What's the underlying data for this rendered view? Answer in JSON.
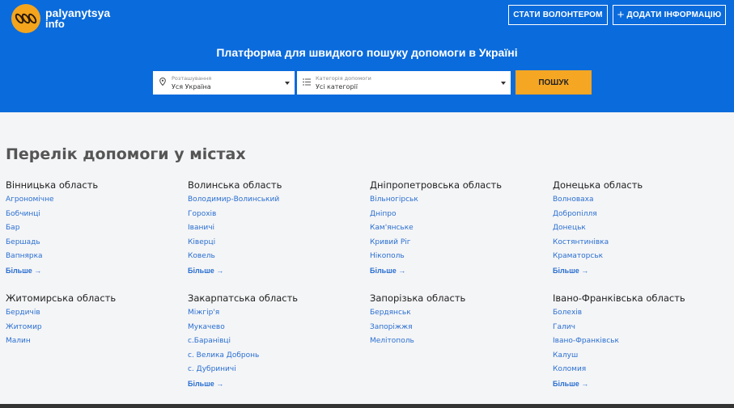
{
  "header": {
    "logo_line1": "palyanytsya",
    "logo_line2": "info",
    "volunteer_button": "СТАТИ ВОЛОНТЕРОМ",
    "add_button_plus": "+",
    "add_button": "ДОДАТИ ІНФОРМАЦІЮ",
    "hero_title": "Платформа для швидкого пошуку допомоги в Україні"
  },
  "search": {
    "region_label": "Розташування",
    "region_value": "Уся Україна",
    "category_label": "Категорія допомоги",
    "category_value": "Усі категорії",
    "search_button": "ПОШУК"
  },
  "main": {
    "section_title": "Перелік допомоги у містах",
    "more_label": "Більше →",
    "regions": [
      {
        "name": "Вінницька область",
        "cities": [
          "Агрономічне",
          "Бобчинці",
          "Бар",
          "Бершадь",
          "Вапнярка"
        ],
        "more": true
      },
      {
        "name": "Волинська область",
        "cities": [
          "Володимир-Волинський",
          "Горохів",
          "Іваничі",
          "Ківерці",
          "Ковель"
        ],
        "more": true
      },
      {
        "name": "Дніпропетровська область",
        "cities": [
          "Вільногірськ",
          "Дніпро",
          "Кам'янське",
          "Кривий Ріг",
          "Нікополь"
        ],
        "more": true
      },
      {
        "name": "Донецька область",
        "cities": [
          "Волноваха",
          "Добропілля",
          "Донецьк",
          "Костянтинівка",
          "Краматорськ"
        ],
        "more": true
      },
      {
        "name": "Житомирська область",
        "cities": [
          "Бердичів",
          "Житомир",
          "Малин"
        ],
        "more": false
      },
      {
        "name": "Закарпатська область",
        "cities": [
          "Міжгір'я",
          "Мукачево",
          "с.Баранівці",
          "с. Велика Добронь",
          "с. Дубриничі"
        ],
        "more": true
      },
      {
        "name": "Запорізька область",
        "cities": [
          "Бердянськ",
          "Запоріжжя",
          "Мелітополь"
        ],
        "more": false
      },
      {
        "name": "Івано-Франківська область",
        "cities": [
          "Болехів",
          "Галич",
          "Івано-Франківськ",
          "Калуш",
          "Коломия"
        ],
        "more": true
      }
    ]
  }
}
